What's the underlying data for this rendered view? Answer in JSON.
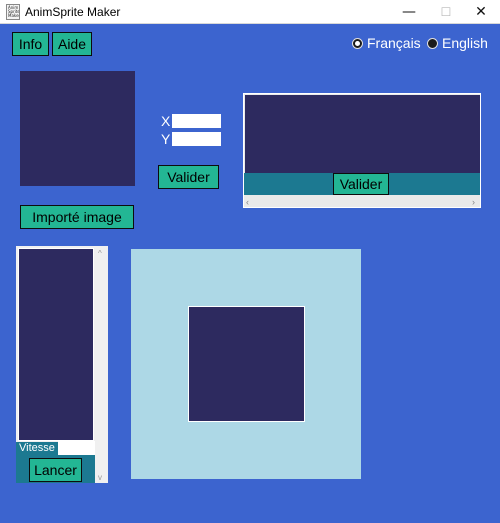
{
  "window": {
    "title": "AnimSprite Maker",
    "icon_text": "Anim Sprite Maker",
    "minimize_glyph": "—",
    "maximize_glyph": "☐",
    "close_glyph": "✕"
  },
  "toolbar": {
    "info_label": "Info",
    "aide_label": "Aide"
  },
  "language": {
    "options": [
      "Français",
      "English"
    ],
    "selected": "Français"
  },
  "position": {
    "x_label": "X",
    "y_label": "Y",
    "x_value": "",
    "y_value": ""
  },
  "buttons": {
    "valider_label": "Valider",
    "import_label": "Importé image",
    "frames_valider_label": "Valider",
    "lancer_label": "Lancer"
  },
  "animation": {
    "vitesse_label": "Vitesse",
    "vitesse_value": ""
  },
  "scrollbar_glyphs": {
    "left": "‹",
    "right": "›",
    "up": "^",
    "down": "v"
  },
  "colors": {
    "background": "#3c64cf",
    "panel_dark": "#2d2a5f",
    "button": "#23b694",
    "bar_teal": "#1c7991",
    "canvas": "#add8e6"
  }
}
